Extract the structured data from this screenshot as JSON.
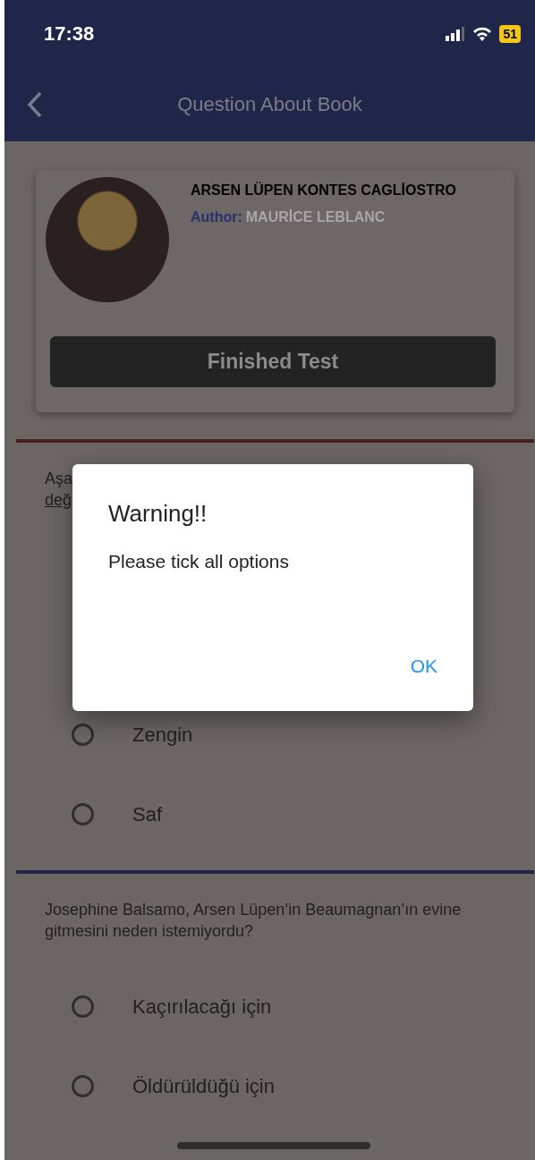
{
  "status_bar": {
    "time": "17:38",
    "battery": "51"
  },
  "app_bar": {
    "title": "Question About Book"
  },
  "book": {
    "title": "ARSEN LÜPEN KONTES CAGLİOSTRO",
    "author_label": "Author:",
    "author": "MAURİCE LEBLANC",
    "button": "Finished Test"
  },
  "questions": [
    {
      "color": "#4a1d1e",
      "lines": [
        "Aşa",
        "değ"
      ],
      "options": [
        {
          "label": "Zengin",
          "selected": false
        },
        {
          "label": "Saf",
          "selected": false
        }
      ]
    },
    {
      "color": "#20254a",
      "lines": [
        "Josephine Balsamo, Arsen Lüpen’in Beaumagnan’ın evine gitmesini neden istemiyordu?"
      ],
      "options": [
        {
          "label": "Kaçırılacağı için",
          "selected": false
        },
        {
          "label": "Öldürüldüğü için",
          "selected": false
        }
      ]
    }
  ],
  "dialog": {
    "title": "Warning!!",
    "message": "Please tick all options",
    "button": "OK"
  }
}
